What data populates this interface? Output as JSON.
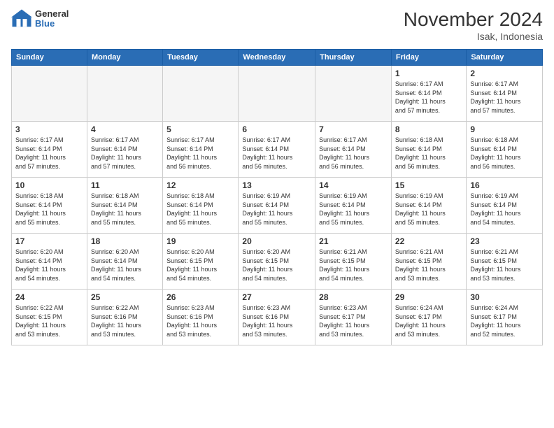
{
  "logo": {
    "general": "General",
    "blue": "Blue"
  },
  "title": "November 2024",
  "location": "Isak, Indonesia",
  "weekdays": [
    "Sunday",
    "Monday",
    "Tuesday",
    "Wednesday",
    "Thursday",
    "Friday",
    "Saturday"
  ],
  "weeks": [
    [
      {
        "day": "",
        "info": ""
      },
      {
        "day": "",
        "info": ""
      },
      {
        "day": "",
        "info": ""
      },
      {
        "day": "",
        "info": ""
      },
      {
        "day": "",
        "info": ""
      },
      {
        "day": "1",
        "info": "Sunrise: 6:17 AM\nSunset: 6:14 PM\nDaylight: 11 hours\nand 57 minutes."
      },
      {
        "day": "2",
        "info": "Sunrise: 6:17 AM\nSunset: 6:14 PM\nDaylight: 11 hours\nand 57 minutes."
      }
    ],
    [
      {
        "day": "3",
        "info": "Sunrise: 6:17 AM\nSunset: 6:14 PM\nDaylight: 11 hours\nand 57 minutes."
      },
      {
        "day": "4",
        "info": "Sunrise: 6:17 AM\nSunset: 6:14 PM\nDaylight: 11 hours\nand 57 minutes."
      },
      {
        "day": "5",
        "info": "Sunrise: 6:17 AM\nSunset: 6:14 PM\nDaylight: 11 hours\nand 56 minutes."
      },
      {
        "day": "6",
        "info": "Sunrise: 6:17 AM\nSunset: 6:14 PM\nDaylight: 11 hours\nand 56 minutes."
      },
      {
        "day": "7",
        "info": "Sunrise: 6:17 AM\nSunset: 6:14 PM\nDaylight: 11 hours\nand 56 minutes."
      },
      {
        "day": "8",
        "info": "Sunrise: 6:18 AM\nSunset: 6:14 PM\nDaylight: 11 hours\nand 56 minutes."
      },
      {
        "day": "9",
        "info": "Sunrise: 6:18 AM\nSunset: 6:14 PM\nDaylight: 11 hours\nand 56 minutes."
      }
    ],
    [
      {
        "day": "10",
        "info": "Sunrise: 6:18 AM\nSunset: 6:14 PM\nDaylight: 11 hours\nand 55 minutes."
      },
      {
        "day": "11",
        "info": "Sunrise: 6:18 AM\nSunset: 6:14 PM\nDaylight: 11 hours\nand 55 minutes."
      },
      {
        "day": "12",
        "info": "Sunrise: 6:18 AM\nSunset: 6:14 PM\nDaylight: 11 hours\nand 55 minutes."
      },
      {
        "day": "13",
        "info": "Sunrise: 6:19 AM\nSunset: 6:14 PM\nDaylight: 11 hours\nand 55 minutes."
      },
      {
        "day": "14",
        "info": "Sunrise: 6:19 AM\nSunset: 6:14 PM\nDaylight: 11 hours\nand 55 minutes."
      },
      {
        "day": "15",
        "info": "Sunrise: 6:19 AM\nSunset: 6:14 PM\nDaylight: 11 hours\nand 55 minutes."
      },
      {
        "day": "16",
        "info": "Sunrise: 6:19 AM\nSunset: 6:14 PM\nDaylight: 11 hours\nand 54 minutes."
      }
    ],
    [
      {
        "day": "17",
        "info": "Sunrise: 6:20 AM\nSunset: 6:14 PM\nDaylight: 11 hours\nand 54 minutes."
      },
      {
        "day": "18",
        "info": "Sunrise: 6:20 AM\nSunset: 6:14 PM\nDaylight: 11 hours\nand 54 minutes."
      },
      {
        "day": "19",
        "info": "Sunrise: 6:20 AM\nSunset: 6:15 PM\nDaylight: 11 hours\nand 54 minutes."
      },
      {
        "day": "20",
        "info": "Sunrise: 6:20 AM\nSunset: 6:15 PM\nDaylight: 11 hours\nand 54 minutes."
      },
      {
        "day": "21",
        "info": "Sunrise: 6:21 AM\nSunset: 6:15 PM\nDaylight: 11 hours\nand 54 minutes."
      },
      {
        "day": "22",
        "info": "Sunrise: 6:21 AM\nSunset: 6:15 PM\nDaylight: 11 hours\nand 53 minutes."
      },
      {
        "day": "23",
        "info": "Sunrise: 6:21 AM\nSunset: 6:15 PM\nDaylight: 11 hours\nand 53 minutes."
      }
    ],
    [
      {
        "day": "24",
        "info": "Sunrise: 6:22 AM\nSunset: 6:15 PM\nDaylight: 11 hours\nand 53 minutes."
      },
      {
        "day": "25",
        "info": "Sunrise: 6:22 AM\nSunset: 6:16 PM\nDaylight: 11 hours\nand 53 minutes."
      },
      {
        "day": "26",
        "info": "Sunrise: 6:23 AM\nSunset: 6:16 PM\nDaylight: 11 hours\nand 53 minutes."
      },
      {
        "day": "27",
        "info": "Sunrise: 6:23 AM\nSunset: 6:16 PM\nDaylight: 11 hours\nand 53 minutes."
      },
      {
        "day": "28",
        "info": "Sunrise: 6:23 AM\nSunset: 6:17 PM\nDaylight: 11 hours\nand 53 minutes."
      },
      {
        "day": "29",
        "info": "Sunrise: 6:24 AM\nSunset: 6:17 PM\nDaylight: 11 hours\nand 53 minutes."
      },
      {
        "day": "30",
        "info": "Sunrise: 6:24 AM\nSunset: 6:17 PM\nDaylight: 11 hours\nand 52 minutes."
      }
    ]
  ]
}
